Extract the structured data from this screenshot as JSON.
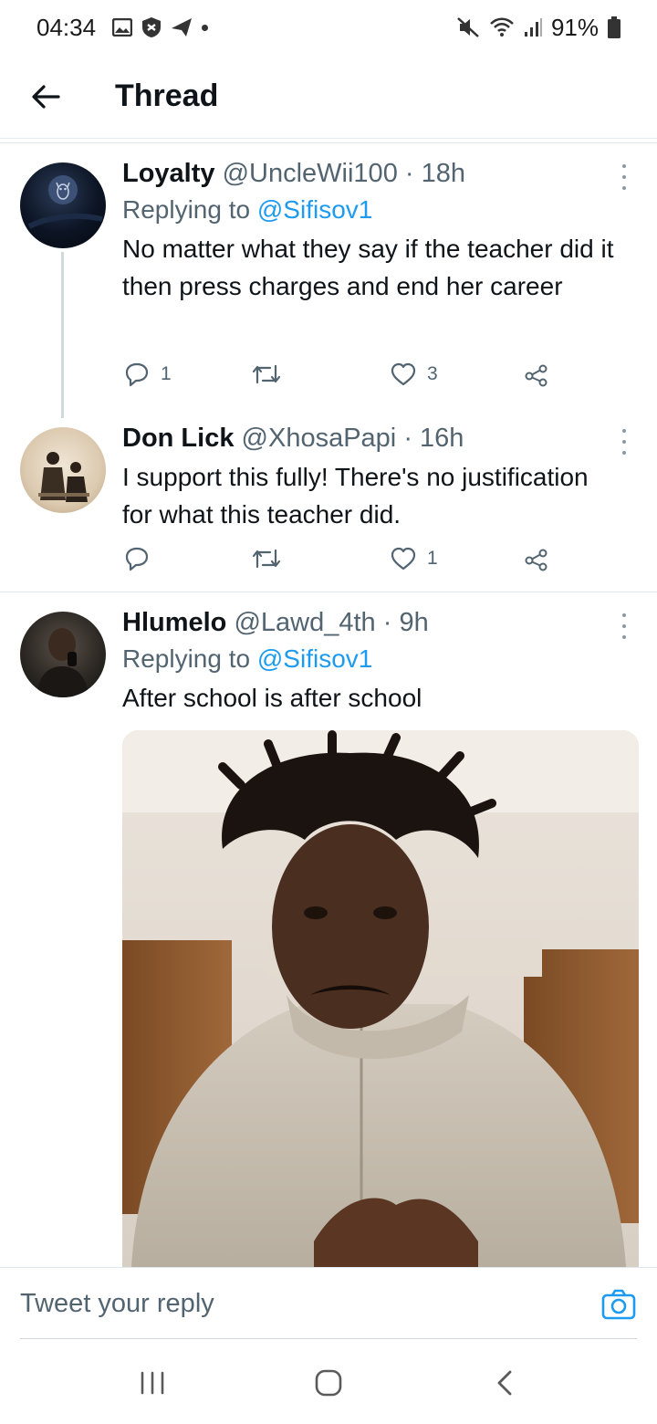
{
  "status_bar": {
    "time": "04:34",
    "battery": "91%",
    "left_icons": [
      "gallery-icon",
      "shield-icon",
      "send-icon",
      "dot"
    ],
    "right_icons": [
      "mute-icon",
      "wifi-icon",
      "signal-icon",
      "battery-icon"
    ]
  },
  "header": {
    "title": "Thread",
    "back_icon": "arrow-left-icon"
  },
  "colors": {
    "accent": "#1d9bf0",
    "secondary_text": "#536471",
    "primary_text": "#0f1419"
  },
  "tweets": [
    {
      "name": "Loyalty",
      "handle": "@UncleWii100",
      "sep": "·",
      "time": "18h",
      "replying_prefix": "Replying to ",
      "replying_to": "@Sifisov1",
      "text": "No matter what they say if the teacher did it then press charges and end her career",
      "replies": "1",
      "retweets": "",
      "likes": "3"
    },
    {
      "name": "Don Lick",
      "handle": "@XhosaPapi",
      "sep": "·",
      "time": "16h",
      "text": "I support this fully! There's no justification for what this teacher did.",
      "replies": "",
      "retweets": "",
      "likes": "1"
    },
    {
      "name": "Hlumelo",
      "handle": "@Lawd_4th",
      "sep": "·",
      "time": "9h",
      "replying_prefix": "Replying to ",
      "replying_to": "@Sifisov1",
      "text": "After school is after school",
      "has_media": true
    }
  ],
  "reply_bar": {
    "placeholder": "Tweet your reply",
    "icon": "camera-icon"
  },
  "nav_bar": {
    "icons": [
      "recents-icon",
      "home-icon",
      "back-icon"
    ]
  }
}
